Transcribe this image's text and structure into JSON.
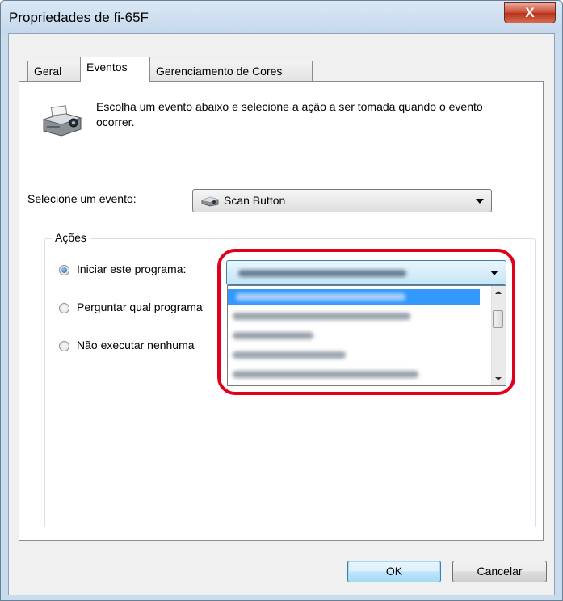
{
  "window": {
    "title": "Propriedades de fi-65F",
    "close_symbol": "X"
  },
  "tabs": [
    {
      "label": "Geral",
      "active": false
    },
    {
      "label": "Eventos",
      "active": true
    },
    {
      "label": "Gerenciamento de Cores",
      "active": false
    }
  ],
  "intro": {
    "icon": "scanner-icon",
    "text": "Escolha um evento abaixo e selecione a ação a ser tomada quando o evento ocorrer."
  },
  "event": {
    "label": "Selecione um evento:",
    "selected": "Scan Button",
    "icon": "scanner-icon"
  },
  "actions": {
    "group_title": "Ações",
    "options": [
      {
        "label": "Iniciar este programa:",
        "checked": true
      },
      {
        "label": "Perguntar qual programa",
        "checked": false
      },
      {
        "label": "Não executar nenhuma",
        "checked": false
      }
    ]
  },
  "buttons": {
    "ok": "OK",
    "cancel": "Cancelar"
  },
  "colors": {
    "highlight": "#e0001b",
    "selection": "#3399ff",
    "title_bar": "#c5d8ec",
    "close_button": "#c7462f"
  }
}
